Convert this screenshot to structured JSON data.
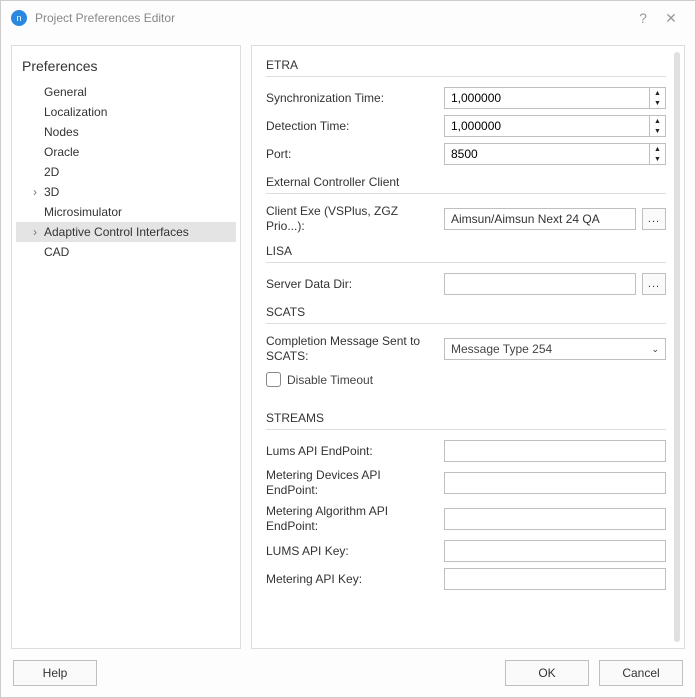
{
  "window": {
    "title": "Project Preferences Editor"
  },
  "tree": {
    "title": "Preferences",
    "items": [
      {
        "label": "General",
        "expandable": false
      },
      {
        "label": "Localization",
        "expandable": false
      },
      {
        "label": "Nodes",
        "expandable": false
      },
      {
        "label": "Oracle",
        "expandable": false
      },
      {
        "label": "2D",
        "expandable": false
      },
      {
        "label": "3D",
        "expandable": true
      },
      {
        "label": "Microsimulator",
        "expandable": false
      },
      {
        "label": "Adaptive Control Interfaces",
        "expandable": true,
        "selected": true
      },
      {
        "label": "CAD",
        "expandable": false
      }
    ]
  },
  "etra": {
    "title": "ETRA",
    "sync_label": "Synchronization Time:",
    "sync_value": "1,000000",
    "detect_label": "Detection Time:",
    "detect_value": "1,000000",
    "port_label": "Port:",
    "port_value": "8500"
  },
  "extctrl": {
    "title": "External Controller Client",
    "client_label": "Client Exe (VSPlus, ZGZ Prio...):",
    "client_value": "Aimsun/Aimsun Next 24 QA"
  },
  "lisa": {
    "title": "LISA",
    "dir_label": "Server Data Dir:",
    "dir_value": ""
  },
  "scats": {
    "title": "SCATS",
    "msg_label": "Completion Message Sent to SCATS:",
    "msg_value": "Message Type 254",
    "disable_label": "Disable Timeout",
    "disable_checked": false
  },
  "streams": {
    "title": "STREAMS",
    "lums_ep_label": "Lums API EndPoint:",
    "lums_ep_value": "",
    "met_dev_label": "Metering Devices API EndPoint:",
    "met_dev_value": "",
    "met_alg_label": "Metering Algorithm API EndPoint:",
    "met_alg_value": "",
    "lums_key_label": "LUMS API Key:",
    "lums_key_value": "",
    "met_key_label": "Metering API Key:",
    "met_key_value": ""
  },
  "footer": {
    "help": "Help",
    "ok": "OK",
    "cancel": "Cancel"
  },
  "glyphs": {
    "chevron_right": "›",
    "chevron_down": "⌄",
    "up": "▲",
    "down": "▼",
    "dots": "...",
    "help": "?",
    "close": "✕"
  }
}
